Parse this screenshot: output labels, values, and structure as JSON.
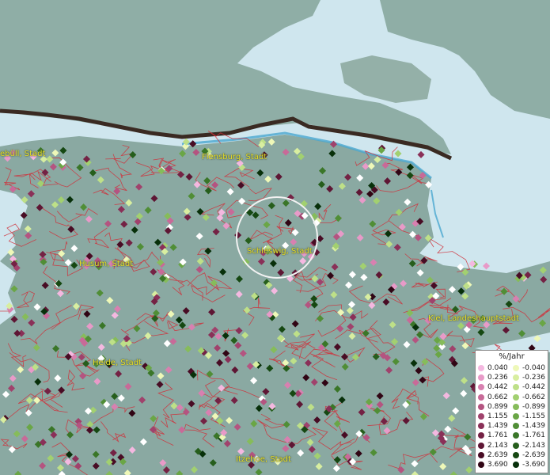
{
  "map": {
    "labels": [
      {
        "name": "city-label-niebuell",
        "text": "ebüll, Stadt"
      },
      {
        "name": "city-label-flensburg",
        "text": "Flensburg, Stadt"
      },
      {
        "name": "city-label-husum",
        "text": "Husum, Stadt"
      },
      {
        "name": "city-label-schleswig",
        "text": "Schleswig, Stadt"
      },
      {
        "name": "city-label-kiel",
        "text": "Kiel, Landeshauptstadt"
      },
      {
        "name": "city-label-heide",
        "text": "Heide, Stadt"
      },
      {
        "name": "city-label-itzehoe",
        "text": "Itzehoe, Stadt"
      }
    ],
    "highlight": "Schleswig, Stadt"
  },
  "legend": {
    "title": "%/Jahr",
    "positive": [
      {
        "label": "0.040",
        "color": "#f4b8e0"
      },
      {
        "label": "0.236",
        "color": "#e89ac8"
      },
      {
        "label": "0.442",
        "color": "#d880b0"
      },
      {
        "label": "0.662",
        "color": "#c86a98"
      },
      {
        "label": "0.899",
        "color": "#b45480"
      },
      {
        "label": "1.155",
        "color": "#a0426c"
      },
      {
        "label": "1.439",
        "color": "#8a3058"
      },
      {
        "label": "1.761",
        "color": "#742244"
      },
      {
        "label": "2.143",
        "color": "#5e1634"
      },
      {
        "label": "2.639",
        "color": "#480c24"
      },
      {
        "label": "3.690",
        "color": "#300514"
      }
    ],
    "negative": [
      {
        "label": "-0.040",
        "color": "#eef8b8"
      },
      {
        "label": "-0.236",
        "color": "#d8eea0"
      },
      {
        "label": "-0.442",
        "color": "#bee088"
      },
      {
        "label": "-0.662",
        "color": "#a2d070"
      },
      {
        "label": "-0.899",
        "color": "#86bc5a"
      },
      {
        "label": "-1.155",
        "color": "#6aa646"
      },
      {
        "label": "-1.439",
        "color": "#508e36"
      },
      {
        "label": "-1.761",
        "color": "#3a7628"
      },
      {
        "label": "-2.143",
        "color": "#265e1c"
      },
      {
        "label": "-2.639",
        "color": "#164812"
      },
      {
        "label": "-3.690",
        "color": "#08300a"
      }
    ]
  }
}
